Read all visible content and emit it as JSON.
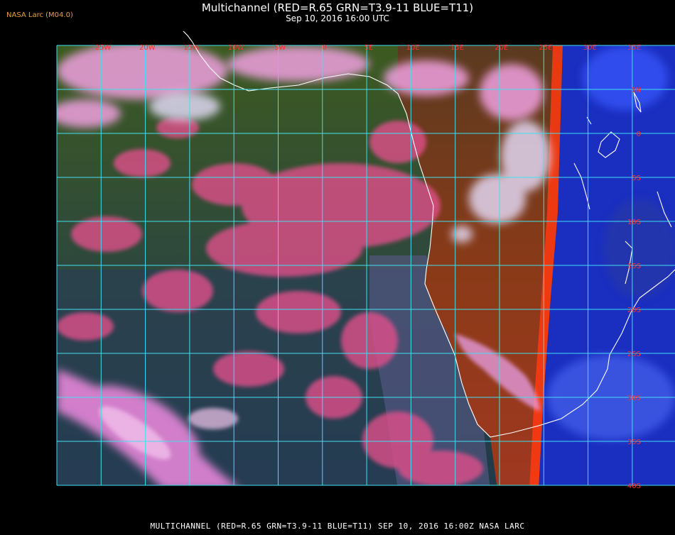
{
  "header": {
    "title": "Multichannel (RED=R.65 GRN=T3.9-11 BLUE=T11)",
    "datetime": "Sep 10, 2016 16:00 UTC",
    "source": "NASA Larc (M04.0)"
  },
  "footer": {
    "caption": "MULTICHANNEL (RED=R.65 GRN=T3.9-11 BLUE=T11) SEP 10, 2016 16:00Z  NASA LARC"
  },
  "map": {
    "grid_color": "#40e0f0",
    "label_color": "#ff3030",
    "coastline_color": "#ffffff",
    "longitude_labels": [
      "25W",
      "20W",
      "15W",
      "10W",
      "5W",
      "0",
      "5E",
      "10E",
      "15E",
      "20E",
      "25E",
      "30E",
      "35E"
    ],
    "latitude_labels": [
      "5N",
      "0",
      "5S",
      "10S",
      "15S",
      "20S",
      "25S",
      "30S",
      "35S",
      "40S"
    ]
  }
}
